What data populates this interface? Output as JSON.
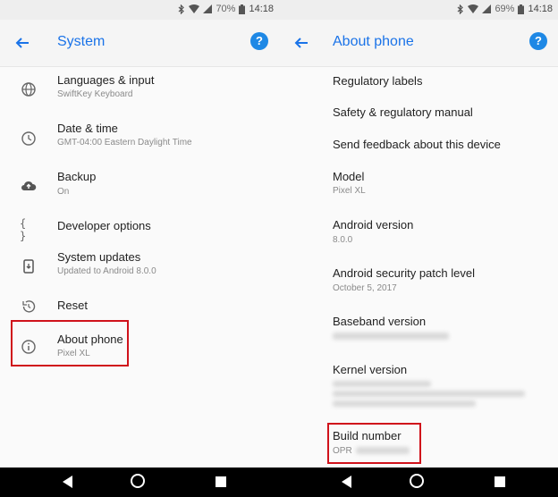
{
  "left": {
    "status": {
      "battery": "70%",
      "time": "14:18"
    },
    "appbar": {
      "title": "System",
      "help_icon": "?"
    },
    "items": [
      {
        "icon": "globe-icon",
        "title": "Languages & input",
        "subtitle": "SwiftKey Keyboard"
      },
      {
        "icon": "clock-icon",
        "title": "Date & time",
        "subtitle": "GMT-04:00 Eastern Daylight Time"
      },
      {
        "icon": "cloud-upload-icon",
        "title": "Backup",
        "subtitle": "On"
      },
      {
        "icon": "braces-icon",
        "title": "Developer options",
        "subtitle": ""
      },
      {
        "icon": "system-update-icon",
        "title": "System updates",
        "subtitle": "Updated to Android 8.0.0"
      },
      {
        "icon": "history-icon",
        "title": "Reset",
        "subtitle": ""
      },
      {
        "icon": "info-icon",
        "title": "About phone",
        "subtitle": "Pixel XL"
      }
    ]
  },
  "right": {
    "status": {
      "battery": "69%",
      "time": "14:18"
    },
    "appbar": {
      "title": "About phone",
      "help_icon": "?"
    },
    "items": [
      {
        "title": "Regulatory labels",
        "subtitle": ""
      },
      {
        "title": "Safety & regulatory manual",
        "subtitle": ""
      },
      {
        "title": "Send feedback about this device",
        "subtitle": ""
      },
      {
        "title": "Model",
        "subtitle": "Pixel XL"
      },
      {
        "title": "Android version",
        "subtitle": "8.0.0"
      },
      {
        "title": "Android security patch level",
        "subtitle": "October 5, 2017"
      },
      {
        "title": "Baseband version",
        "subtitle": ""
      },
      {
        "title": "Kernel version",
        "subtitle": ""
      },
      {
        "title": "Build number",
        "subtitle": "OPR"
      }
    ]
  },
  "colors": {
    "accent": "#1a73e8",
    "highlight": "#d0121b",
    "nav_bar": "#000000"
  }
}
